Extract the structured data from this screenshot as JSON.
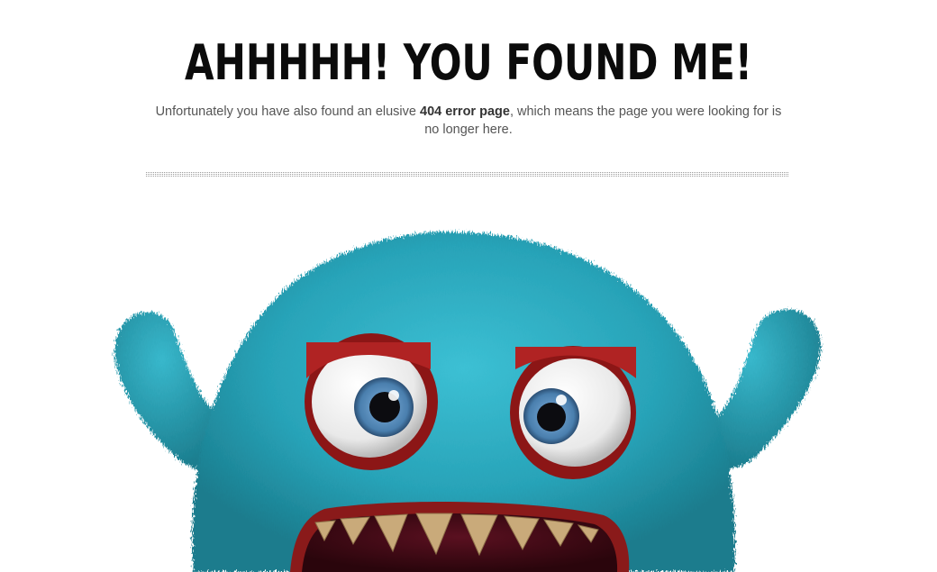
{
  "error_page": {
    "headline": "AHHHHH! YOU FOUND ME!",
    "message_before": "Unfortunately you have also found an elusive ",
    "message_bold": "404 error page",
    "message_after": ", which means the page you were looking for is no longer here."
  },
  "colors": {
    "fur": "#2aa7bd",
    "fur_dark": "#1b7f91",
    "eye_rim": "#a51d1d",
    "iris": "#4f86b5",
    "mouth": "#3a0a12",
    "teeth": "#c8a877"
  },
  "illustration": {
    "icon": "furry-blue-monster-icon"
  }
}
